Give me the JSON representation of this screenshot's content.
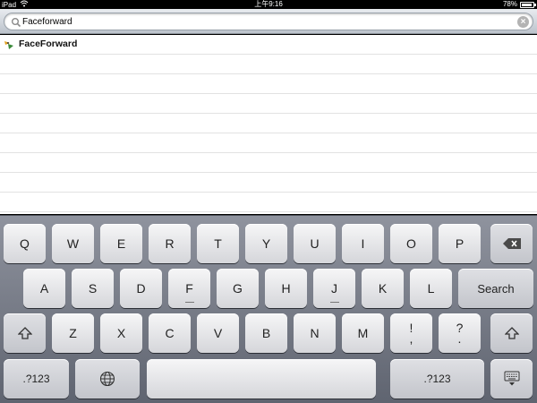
{
  "status_bar": {
    "device": "iPad",
    "time": "上午9:16",
    "battery": "78%",
    "battery_level": 0.78
  },
  "search": {
    "value": "Faceforward",
    "clear_icon": "clear-icon",
    "search_icon": "search-icon"
  },
  "results": [
    {
      "label": "FaceForward",
      "icon": "app-icon"
    }
  ],
  "keyboard": {
    "row1": [
      "Q",
      "W",
      "E",
      "R",
      "T",
      "Y",
      "U",
      "I",
      "O",
      "P"
    ],
    "row2": [
      "A",
      "S",
      "D",
      "F",
      "G",
      "H",
      "J",
      "K",
      "L"
    ],
    "row3": [
      "Z",
      "X",
      "C",
      "V",
      "B",
      "N",
      "M"
    ],
    "punct_1_top": "!",
    "punct_1_bottom": ",",
    "punct_2_top": "?",
    "punct_2_bottom": ".",
    "search_label": "Search",
    "numbers_left": ".?123",
    "numbers_right": ".?123",
    "space_label": ""
  },
  "colors": {
    "keyboard_bg_top": "#8f939e",
    "keyboard_bg_bottom": "#5f6470",
    "key_face": "#f2f2f3"
  }
}
